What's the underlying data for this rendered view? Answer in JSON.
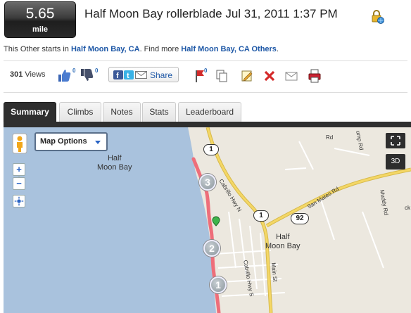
{
  "activity": {
    "distance_value": "5.65",
    "distance_unit": "mile",
    "title": "Half Moon Bay rollerblade Jul 31, 2011 1:37 PM",
    "desc_prefix": "This Other starts in ",
    "start_link": "Half Moon Bay, CA",
    "desc_middle": ". Find more ",
    "more_link": "Half Moon Bay, CA Others",
    "desc_suffix": "."
  },
  "stats": {
    "views_count": "301",
    "views_label": " Views",
    "likes_count": "0",
    "dislikes_count": "0",
    "flags_count": "0"
  },
  "share": {
    "label": "Share"
  },
  "tabs": [
    {
      "label": "Summary",
      "active": true
    },
    {
      "label": "Climbs",
      "active": false
    },
    {
      "label": "Notes",
      "active": false
    },
    {
      "label": "Stats",
      "active": false
    },
    {
      "label": "Leaderboard",
      "active": false
    }
  ],
  "map": {
    "options_label": "Map Options",
    "zoom_in": "+",
    "zoom_out": "−",
    "threed_label": "3D",
    "ocean_label_line1": "Half",
    "ocean_label_line2": "Moon Bay",
    "town_label_line1": "Half",
    "town_label_line2": "Moon Bay",
    "roads": {
      "cabrillo_n": "Cabrillo Hwy N",
      "cabrillo_s": "Cabrillo Hwy S",
      "san_mateo": "San Mateo Rd",
      "main_st": "Main St",
      "muddy": "Muddy Rd",
      "ump": "ump Rd",
      "rd_top": "Rd",
      "ck": "ck"
    },
    "shields": {
      "hwy1_top": "1",
      "hwy1_mid": "1",
      "hwy92": "92"
    },
    "markers": [
      "3",
      "2",
      "1"
    ],
    "colors": {
      "water": "#a9c2dd",
      "land": "#ece8df",
      "route": "#ee6e7a",
      "highway": "#f4d766",
      "street": "#ffffff"
    }
  }
}
